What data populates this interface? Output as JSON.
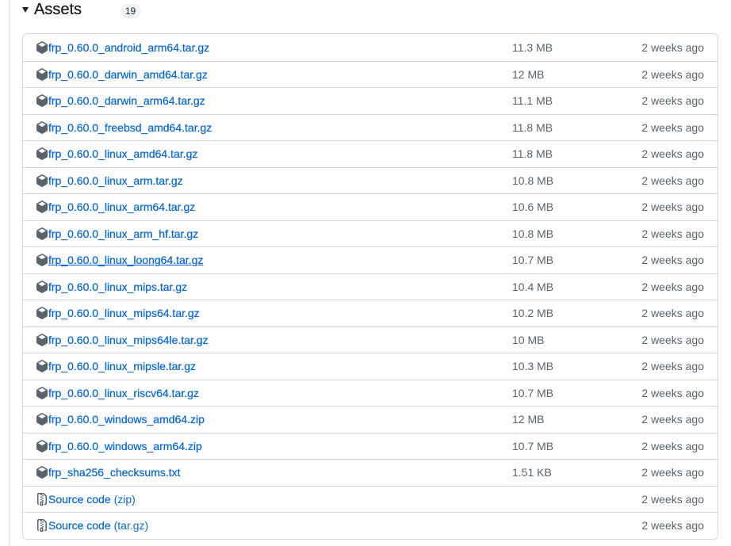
{
  "section": {
    "title": "Assets",
    "count": "19"
  },
  "colors": {
    "link": "#0969da",
    "muted": "#59636e",
    "border": "#d1d9e0",
    "badge_bg": "#eff2f5",
    "text": "#1f2328"
  },
  "assets": [
    {
      "icon": "package-icon",
      "name": "frp_0.60.0_android_arm64.tar.gz",
      "size": "11.3 MB",
      "date": "2 weeks ago"
    },
    {
      "icon": "package-icon",
      "name": "frp_0.60.0_darwin_amd64.tar.gz",
      "size": "12 MB",
      "date": "2 weeks ago"
    },
    {
      "icon": "package-icon",
      "name": "frp_0.60.0_darwin_arm64.tar.gz",
      "size": "11.1 MB",
      "date": "2 weeks ago"
    },
    {
      "icon": "package-icon",
      "name": "frp_0.60.0_freebsd_amd64.tar.gz",
      "size": "11.8 MB",
      "date": "2 weeks ago"
    },
    {
      "icon": "package-icon",
      "name": "frp_0.60.0_linux_amd64.tar.gz",
      "size": "11.8 MB",
      "date": "2 weeks ago"
    },
    {
      "icon": "package-icon",
      "name": "frp_0.60.0_linux_arm.tar.gz",
      "size": "10.8 MB",
      "date": "2 weeks ago"
    },
    {
      "icon": "package-icon",
      "name": "frp_0.60.0_linux_arm64.tar.gz",
      "size": "10.6 MB",
      "date": "2 weeks ago"
    },
    {
      "icon": "package-icon",
      "name": "frp_0.60.0_linux_arm_hf.tar.gz",
      "size": "10.8 MB",
      "date": "2 weeks ago"
    },
    {
      "icon": "package-icon",
      "name": "frp_0.60.0_linux_loong64.tar.gz",
      "size": "10.7 MB",
      "date": "2 weeks ago",
      "hovered": true
    },
    {
      "icon": "package-icon",
      "name": "frp_0.60.0_linux_mips.tar.gz",
      "size": "10.4 MB",
      "date": "2 weeks ago"
    },
    {
      "icon": "package-icon",
      "name": "frp_0.60.0_linux_mips64.tar.gz",
      "size": "10.2 MB",
      "date": "2 weeks ago"
    },
    {
      "icon": "package-icon",
      "name": "frp_0.60.0_linux_mips64le.tar.gz",
      "size": "10 MB",
      "date": "2 weeks ago"
    },
    {
      "icon": "package-icon",
      "name": "frp_0.60.0_linux_mipsle.tar.gz",
      "size": "10.3 MB",
      "date": "2 weeks ago"
    },
    {
      "icon": "package-icon",
      "name": "frp_0.60.0_linux_riscv64.tar.gz",
      "size": "10.7 MB",
      "date": "2 weeks ago"
    },
    {
      "icon": "package-icon",
      "name": "frp_0.60.0_windows_amd64.zip",
      "size": "12 MB",
      "date": "2 weeks ago"
    },
    {
      "icon": "package-icon",
      "name": "frp_0.60.0_windows_arm64.zip",
      "size": "10.7 MB",
      "date": "2 weeks ago"
    },
    {
      "icon": "package-icon",
      "name": "frp_sha256_checksums.txt",
      "size": "1.51 KB",
      "date": "2 weeks ago"
    },
    {
      "icon": "file-zip-icon",
      "name": "Source code",
      "suffix": "(zip)",
      "date": "2 weeks ago"
    },
    {
      "icon": "file-zip-icon",
      "name": "Source code",
      "suffix": "(tar.gz)",
      "date": "2 weeks ago"
    }
  ]
}
